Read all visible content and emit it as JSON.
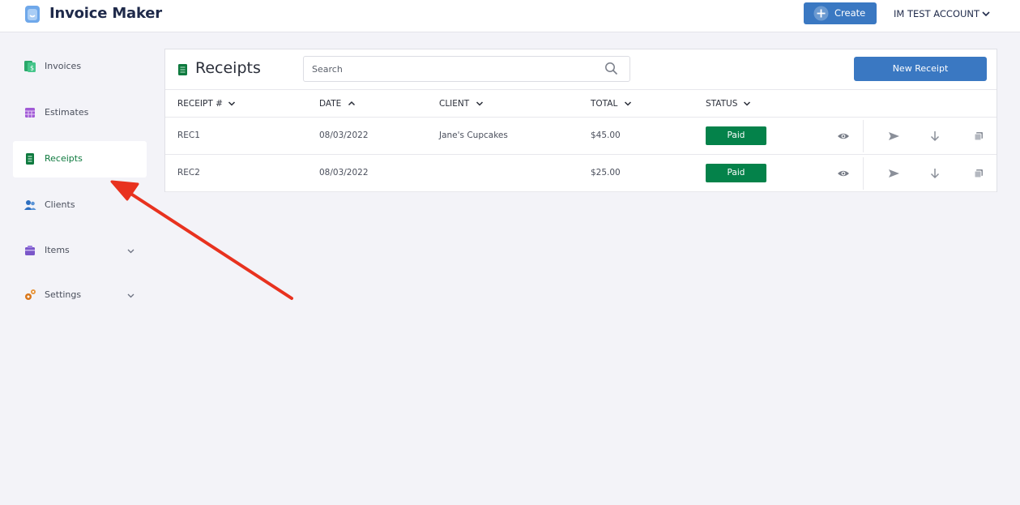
{
  "header": {
    "app_title": "Invoice Maker",
    "create_label": "Create",
    "account_label": "IM TEST ACCOUNT"
  },
  "sidebar": {
    "items": [
      {
        "label": "Invoices",
        "icon": "invoice-icon"
      },
      {
        "label": "Estimates",
        "icon": "estimate-icon"
      },
      {
        "label": "Receipts",
        "icon": "receipt-icon",
        "active": true
      },
      {
        "label": "Clients",
        "icon": "clients-icon"
      },
      {
        "label": "Items",
        "icon": "items-icon",
        "expandable": true
      },
      {
        "label": "Settings",
        "icon": "settings-icon",
        "expandable": true
      }
    ]
  },
  "main": {
    "title": "Receipts",
    "search_placeholder": "Search",
    "new_button_label": "New Receipt",
    "columns": [
      {
        "label": "RECEIPT #",
        "sort": "down"
      },
      {
        "label": "DATE",
        "sort": "up"
      },
      {
        "label": "CLIENT",
        "sort": "down"
      },
      {
        "label": "TOTAL",
        "sort": "down"
      },
      {
        "label": "STATUS",
        "sort": "down"
      }
    ],
    "rows": [
      {
        "receipt": "REC1",
        "date": "08/03/2022",
        "client": "Jane's Cupcakes",
        "total": "$45.00",
        "status": "Paid"
      },
      {
        "receipt": "REC2",
        "date": "08/03/2022",
        "client": "",
        "total": "$25.00",
        "status": "Paid"
      }
    ]
  },
  "colors": {
    "accent_blue": "#3a78c2",
    "paid_green": "#04824a",
    "active_nav": "#0f7a3f",
    "annotation_arrow": "#e8321f"
  }
}
